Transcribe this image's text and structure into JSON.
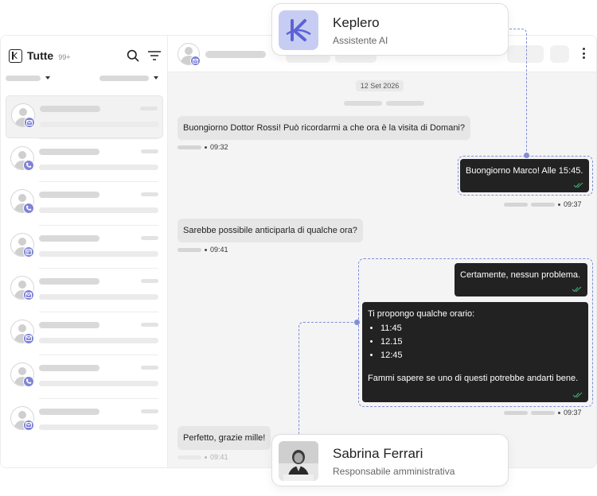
{
  "sidebar": {
    "title": "Tutte",
    "count": "99+",
    "conversations": [
      {
        "channel": "mail"
      },
      {
        "channel": "phone"
      },
      {
        "channel": "phone"
      },
      {
        "channel": "web"
      },
      {
        "channel": "mail"
      },
      {
        "channel": "mail"
      },
      {
        "channel": "phone"
      },
      {
        "channel": "mail"
      }
    ]
  },
  "chat": {
    "date": "12 Set 2026",
    "messages": [
      {
        "direction": "in",
        "text": "Buongiorno Dottor Rossi! Può ricordarmi a che ora è la visita di Domani?",
        "time": "09:32"
      },
      {
        "direction": "out",
        "text": "Buongiorno Marco! Alle 15:45.",
        "time": "09:37"
      },
      {
        "direction": "in",
        "text": "Sarebbe possibile anticiparla di qualche ora?",
        "time": "09:41"
      },
      {
        "direction": "out",
        "text": "Certamente, nessun problema."
      },
      {
        "direction": "out",
        "intro": "Ti propongo qualche orario:",
        "options": [
          "11:45",
          "12.15",
          "12:45"
        ],
        "outro": "Fammi sapere se uno di questi potrebbe andarti bene.",
        "time": "09:37"
      },
      {
        "direction": "in",
        "text": "Perfetto, grazie mille!",
        "time": "09:41"
      }
    ]
  },
  "cards": {
    "ai": {
      "name": "Keplero",
      "role": "Assistente AI",
      "icon": "keplero-logo"
    },
    "human": {
      "name": "Sabrina Ferrari",
      "role": "Responsabile amministrativa",
      "icon": "person-photo"
    }
  },
  "colors": {
    "accent": "#7f83d8",
    "dashed": "#7f8fd6",
    "bubble_out": "#222222",
    "bubble_in": "#e6e6e7",
    "tick": "#3cb371"
  }
}
